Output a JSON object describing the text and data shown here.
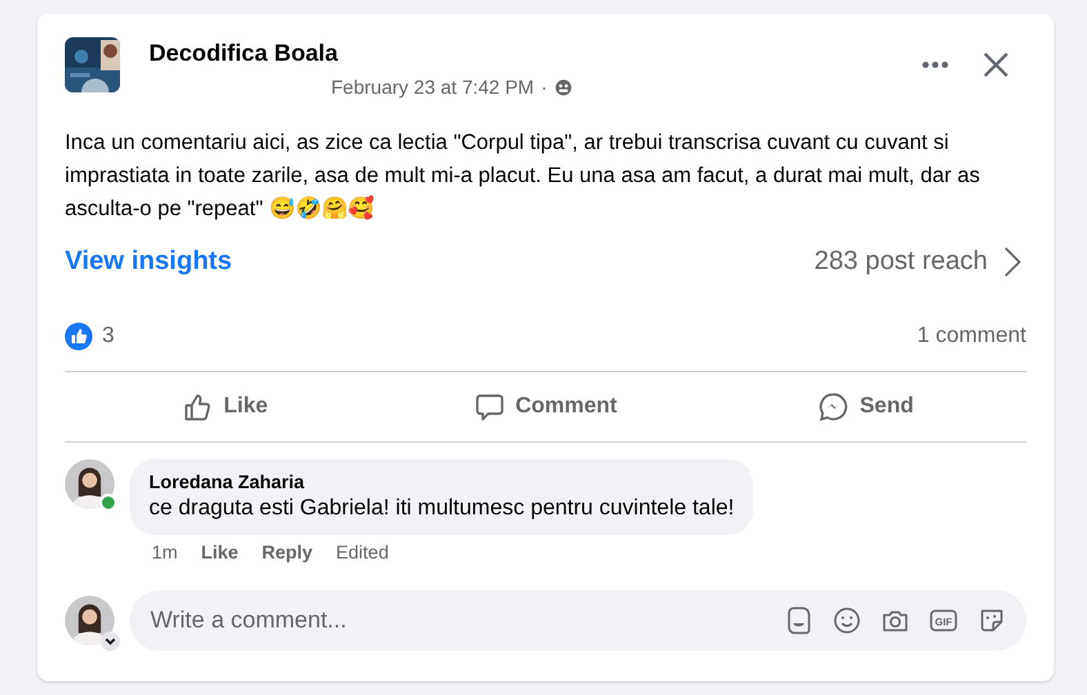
{
  "post": {
    "author": "Decodifica Boala",
    "timestamp": "February 23 at 7:42 PM",
    "separator": "·",
    "body": "Inca un comentariu aici, as zice ca lectia \"Corpul tipa\", ar trebui transcrisa cuvant cu cuvant si imprastiata in toate zarile, asa de mult mi-a placut. Eu una asa am facut, a durat mai mult, dar as asculta-o pe \"repeat\" 😅🤣🤗🥰"
  },
  "insights": {
    "link": "View insights",
    "reach": "283 post reach"
  },
  "stats": {
    "reactions": "3",
    "comments": "1 comment"
  },
  "actions": [
    {
      "kind": "like",
      "label": "Like"
    },
    {
      "kind": "comment",
      "label": "Comment"
    },
    {
      "kind": "send",
      "label": "Send"
    }
  ],
  "comments": [
    {
      "author": "Loredana Zaharia",
      "text": "ce draguta esti Gabriela! iti multumesc pentru cuvintele tale!",
      "online": true,
      "time": "1m",
      "like": "Like",
      "reply": "Reply",
      "edited": "Edited"
    }
  ],
  "composer": {
    "placeholder": "Write a comment...",
    "tools": [
      {
        "kind": "avatar"
      },
      {
        "kind": "emoji"
      },
      {
        "kind": "camera"
      },
      {
        "kind": "gif",
        "label": "GIF"
      },
      {
        "kind": "sticker"
      }
    ]
  }
}
